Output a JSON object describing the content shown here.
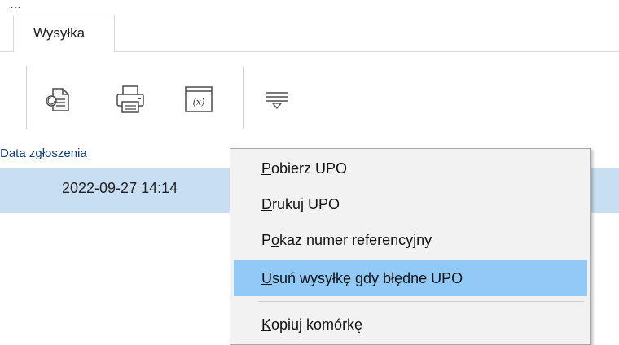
{
  "window": {
    "top_clip_text": "…"
  },
  "tabs": [
    {
      "label": "Wysyłka",
      "active": true
    }
  ],
  "toolbar": {
    "buttons": [
      {
        "icon": "document-refresh-icon"
      },
      {
        "icon": "printer-icon"
      },
      {
        "icon": "formula-x-icon"
      },
      {
        "icon": "filter-lines-icon"
      }
    ]
  },
  "grid": {
    "header": "Data zgłoszenia",
    "rows": [
      {
        "date": "2022-09-27 14:14"
      }
    ],
    "selected_row_color": "#c8dff3"
  },
  "context_menu": {
    "items": [
      {
        "mnemonic": "P",
        "rest": "obierz UPO"
      },
      {
        "mnemonic": "D",
        "rest": "rukuj UPO"
      },
      {
        "prefix": "P",
        "mnemonic": "o",
        "rest": "kaz numer referencyjny"
      },
      {
        "mnemonic": "U",
        "rest": "suń wysyłkę gdy błędne UPO",
        "highlighted": true
      },
      {
        "mnemonic": "K",
        "rest": "opiuj komórkę"
      }
    ],
    "highlight_color": "#91c9f7"
  }
}
